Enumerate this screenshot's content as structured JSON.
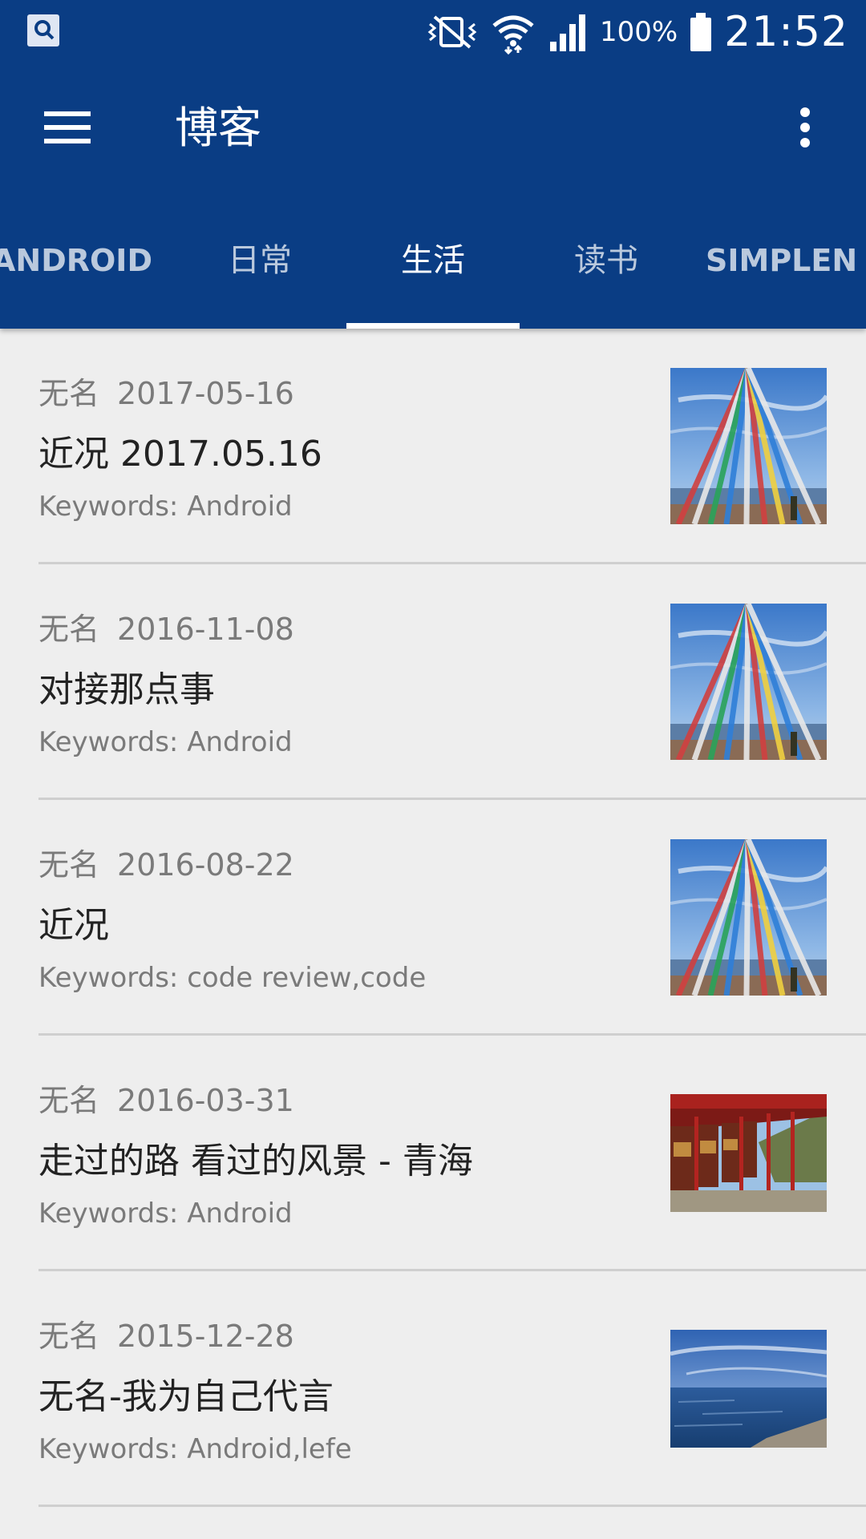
{
  "status_bar": {
    "battery": "100%",
    "time": "21:52",
    "icons": [
      "search-notification-icon",
      "vibrate-off-icon",
      "wifi-icon",
      "signal-icon",
      "battery-icon"
    ]
  },
  "toolbar": {
    "title": "博客",
    "menu_icon": "hamburger-menu-icon",
    "overflow_icon": "more-vert-icon"
  },
  "tabs": [
    {
      "label": "ANDROID",
      "active": false
    },
    {
      "label": "日常",
      "active": false
    },
    {
      "label": "生活",
      "active": true
    },
    {
      "label": "读书",
      "active": false
    },
    {
      "label": "SIMPLEN",
      "active": false
    }
  ],
  "posts": [
    {
      "author": "无名",
      "date": "2017-05-16",
      "title": "近况 2017.05.16",
      "keywords": "Keywords: Android",
      "thumb": "prayer-flags"
    },
    {
      "author": "无名",
      "date": "2016-11-08",
      "title": "对接那点事",
      "keywords": "Keywords: Android",
      "thumb": "prayer-flags"
    },
    {
      "author": "无名",
      "date": "2016-08-22",
      "title": "近况",
      "keywords": "Keywords: code review,code",
      "thumb": "prayer-flags"
    },
    {
      "author": "无名",
      "date": "2016-03-31",
      "title": "走过的路 看过的风景 - 青海",
      "keywords": "Keywords: Android",
      "thumb": "prayer-wheels"
    },
    {
      "author": "无名",
      "date": "2015-12-28",
      "title": "无名-我为自己代言",
      "keywords": "Keywords: Android,lefe",
      "thumb": "lake"
    }
  ],
  "colors": {
    "primary": "#0a3d84",
    "background": "#eeeeee",
    "indicator": "#ffffff"
  }
}
